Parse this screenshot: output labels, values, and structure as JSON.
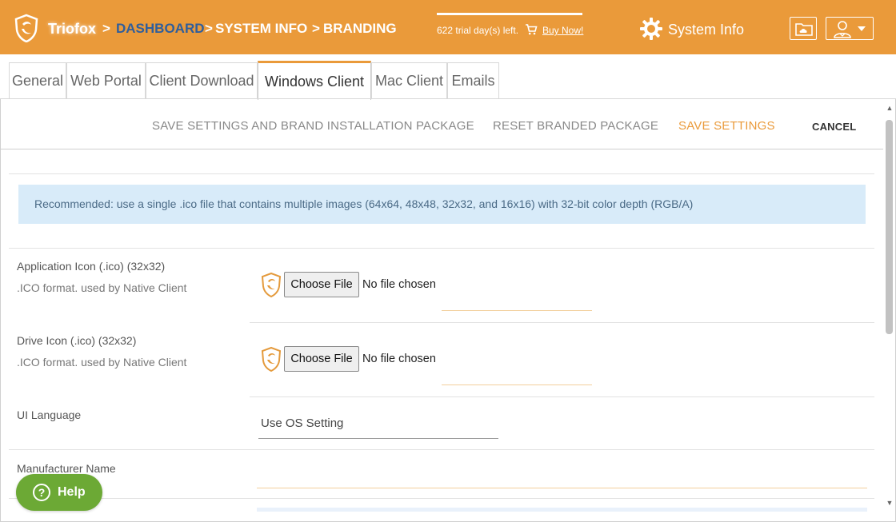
{
  "header": {
    "brand": "Triofox",
    "breadcrumb": [
      {
        "sep": ">",
        "label": "DASHBOARD"
      },
      {
        "sep": ">",
        "label": "SYSTEM INFO"
      },
      {
        "sep": ">",
        "label": "BRANDING"
      }
    ],
    "trial_text": "622 trial day(s) left.",
    "buy_label": "Buy Now!",
    "section_title": "System Info",
    "accent_color": "#ea9a3a",
    "link_color": "#2f5e9c",
    "icons": [
      "triofox-logo-icon",
      "cart-icon",
      "gear-icon",
      "cloud-folder-icon",
      "user-icon",
      "caret-down-icon"
    ]
  },
  "tabs": [
    {
      "label": "General",
      "active": false
    },
    {
      "label": "Web Portal",
      "active": false
    },
    {
      "label": "Client Download",
      "active": false
    },
    {
      "label": "Windows Client",
      "active": true
    },
    {
      "label": "Mac Client",
      "active": false
    },
    {
      "label": "Emails",
      "active": false
    }
  ],
  "actions": {
    "save_and_brand": "SAVE SETTINGS AND BRAND INSTALLATION PACKAGE",
    "reset_branded": "RESET BRANDED PACKAGE",
    "save_settings": "SAVE SETTINGS",
    "cancel": "CANCEL"
  },
  "notice": "Recommended: use a single .ico file that contains multiple images (64x64, 48x48, 32x32, and 16x16) with 32-bit color depth (RGB/A)",
  "fields": {
    "app_icon": {
      "label": "Application Icon (.ico) (32x32)",
      "sublabel": ".ICO format. used by Native Client",
      "button": "Choose File",
      "status": "No file chosen"
    },
    "drive_icon": {
      "label": "Drive Icon (.ico) (32x32)",
      "sublabel": ".ICO format. used by Native Client",
      "button": "Choose File",
      "status": "No file chosen"
    },
    "ui_language": {
      "label": "UI Language",
      "value": "Use OS Setting"
    },
    "manufacturer": {
      "label": "Manufacturer Name",
      "value": ""
    }
  },
  "help": {
    "label": "Help",
    "symbol": "?"
  }
}
